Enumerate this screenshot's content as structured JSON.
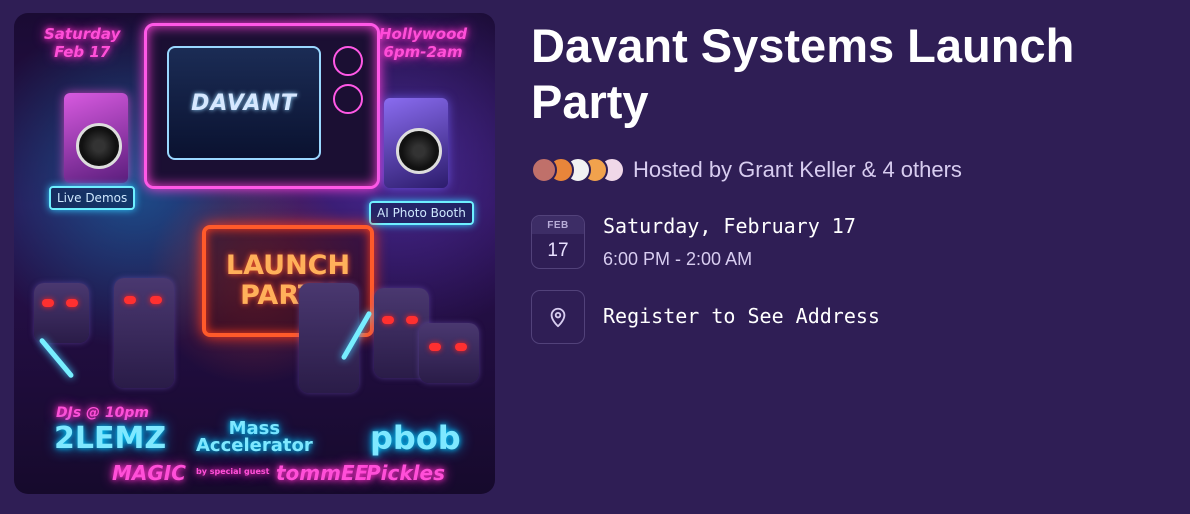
{
  "event": {
    "title": "Davant Systems Launch Party",
    "hosted_by": "Hosted by Grant Keller & 4 others",
    "date_month": "FEB",
    "date_day": "17",
    "date_full": "Saturday, February 17",
    "time_range": "6:00 PM - 2:00 AM",
    "location_text": "Register to See Address"
  },
  "hosts_avatars": [
    {
      "icon": "host-avatar-1",
      "color": "#c0706a"
    },
    {
      "icon": "host-avatar-2",
      "color": "#e8853a"
    },
    {
      "icon": "host-avatar-3",
      "color": "#f2f2f2"
    },
    {
      "icon": "host-avatar-4",
      "color": "#f1a24d"
    },
    {
      "icon": "host-avatar-5",
      "color": "#f0d8e8"
    }
  ],
  "poster": {
    "top_left": "Saturday\nFeb 17",
    "top_right": "Hollywood\n6pm-2am",
    "logo": "DAVANT",
    "sign_left": "Live Demos",
    "sign_right": "AI Photo Booth",
    "launch_line1": "LAUNCH",
    "launch_line2": "PARTY",
    "djs": "DJs @ 10pm",
    "dj1": "2LEMZ",
    "dj2": "Mass\nAccelerator",
    "dj3": "pbob",
    "dj4": "MAGIC",
    "special": "by special guest",
    "dj5": "tommEE",
    "dj6": "Pickles"
  },
  "colors": {
    "background": "#2f1e55",
    "title": "#ffffff",
    "muted": "#d8cdf0",
    "badge_border": "#52427a"
  }
}
